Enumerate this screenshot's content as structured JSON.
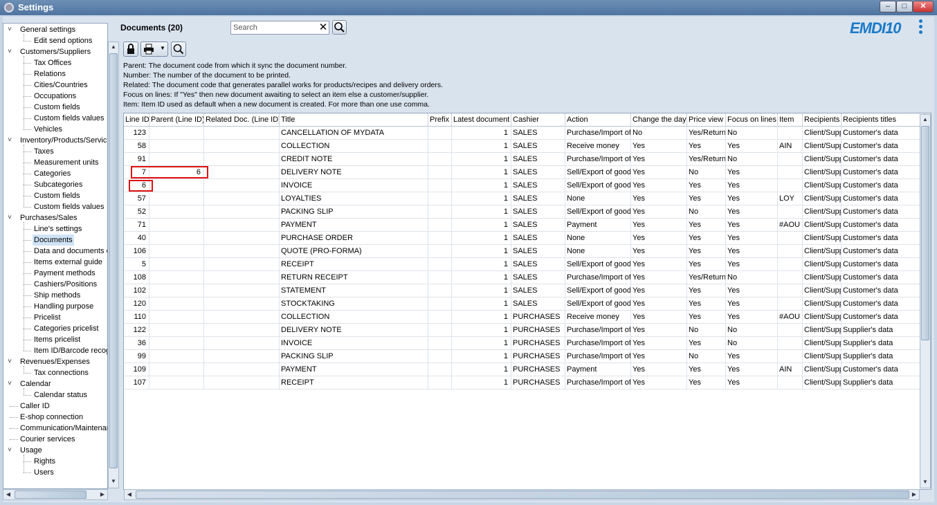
{
  "window": {
    "title": "Settings"
  },
  "sidebar": {
    "items": [
      {
        "label": "General settings",
        "level": 0,
        "expanded": true
      },
      {
        "label": "Edit send options",
        "level": 1
      },
      {
        "label": "Customers/Suppliers",
        "level": 0,
        "expanded": true
      },
      {
        "label": "Tax Offices",
        "level": 1
      },
      {
        "label": "Relations",
        "level": 1
      },
      {
        "label": "Cities/Countries",
        "level": 1
      },
      {
        "label": "Occupations",
        "level": 1
      },
      {
        "label": "Custom fields",
        "level": 1
      },
      {
        "label": "Custom fields values",
        "level": 1
      },
      {
        "label": "Vehicles",
        "level": 1
      },
      {
        "label": "Inventory/Products/Servic",
        "level": 0,
        "expanded": true
      },
      {
        "label": "Taxes",
        "level": 1
      },
      {
        "label": "Measurement units",
        "level": 1
      },
      {
        "label": "Categories",
        "level": 1
      },
      {
        "label": "Subcategories",
        "level": 1
      },
      {
        "label": "Custom fields",
        "level": 1
      },
      {
        "label": "Custom fields values",
        "level": 1
      },
      {
        "label": "Purchases/Sales",
        "level": 0,
        "expanded": true
      },
      {
        "label": "Line's settings",
        "level": 1
      },
      {
        "label": "Documents",
        "level": 1,
        "selected": true
      },
      {
        "label": "Data and documents c",
        "level": 1
      },
      {
        "label": "Items external guide",
        "level": 1
      },
      {
        "label": "Payment methods",
        "level": 1
      },
      {
        "label": "Cashiers/Positions",
        "level": 1
      },
      {
        "label": "Ship methods",
        "level": 1
      },
      {
        "label": "Handling purpose",
        "level": 1
      },
      {
        "label": "Pricelist",
        "level": 1
      },
      {
        "label": "Categories pricelist",
        "level": 1
      },
      {
        "label": "Items pricelist",
        "level": 1
      },
      {
        "label": "Item ID/Barcode recog",
        "level": 1
      },
      {
        "label": "Revenues/Expenses",
        "level": 0,
        "expanded": true
      },
      {
        "label": "Tax connections",
        "level": 1
      },
      {
        "label": "Calendar",
        "level": 0,
        "expanded": true
      },
      {
        "label": "Calendar status",
        "level": 1
      },
      {
        "label": "Caller ID",
        "level": 0
      },
      {
        "label": "E-shop connection",
        "level": 0
      },
      {
        "label": "Communication/Maintenan",
        "level": 0
      },
      {
        "label": "Courier services",
        "level": 0
      },
      {
        "label": "Usage",
        "level": 0,
        "expanded": true
      },
      {
        "label": "Rights",
        "level": 1
      },
      {
        "label": "Users",
        "level": 1
      }
    ]
  },
  "header": {
    "doc_title": "Documents (20)",
    "search_placeholder": "Search",
    "logo": "EMDI10"
  },
  "description": {
    "lines": [
      "Parent: The document code from which it sync the document number.",
      "Number: The number of the document to be printed.",
      "Related: The document code that generates parallel works for products/recipes and delivery orders.",
      "Focus on lines: If \"Yes\" then new document awaiting to select an item else a customer/supplier.",
      "Item: Item ID used as default when a new document is created. For more than one use comma."
    ]
  },
  "grid": {
    "columns": [
      "Line ID",
      "Parent (Line ID)",
      "Related Doc. (Line ID)",
      "Title",
      "Prefix",
      "Latest document",
      "Cashier",
      "Action",
      "Change the day",
      "Price view",
      "Focus on lines",
      "Item",
      "Recipients",
      "Recipients titles"
    ],
    "rows": [
      [
        "123",
        "",
        "",
        "CANCELLATION OF MYDATA",
        "",
        "1",
        "SALES",
        "Purchase/Import of",
        "No",
        "Yes/Return",
        "No",
        "",
        "Client/Supp",
        "Customer's data"
      ],
      [
        "58",
        "",
        "",
        "COLLECTION",
        "",
        "1",
        "SALES",
        "Receive money",
        "Yes",
        "Yes",
        "Yes",
        "AIN",
        "Client/Supp",
        "Customer's data"
      ],
      [
        "91",
        "",
        "",
        "CREDIT NOTE",
        "",
        "1",
        "SALES",
        "Purchase/Import of",
        "Yes",
        "Yes/Return",
        "No",
        "",
        "Client/Supp",
        "Customer's data"
      ],
      [
        "7",
        "6",
        "",
        "DELIVERY NOTE",
        "",
        "1",
        "SALES",
        "Sell/Export of good",
        "Yes",
        "No",
        "Yes",
        "",
        "Client/Supp",
        "Customer's data"
      ],
      [
        "6",
        "",
        "",
        "INVOICE",
        "",
        "1",
        "SALES",
        "Sell/Export of good",
        "Yes",
        "Yes",
        "Yes",
        "",
        "Client/Supp",
        "Customer's data"
      ],
      [
        "57",
        "",
        "",
        "LOYALTIES",
        "",
        "1",
        "SALES",
        "None",
        "Yes",
        "Yes",
        "Yes",
        "LOY",
        "Client/Supp",
        "Customer's data"
      ],
      [
        "52",
        "",
        "",
        "PACKING SLIP",
        "",
        "1",
        "SALES",
        "Sell/Export of good",
        "Yes",
        "No",
        "Yes",
        "",
        "Client/Supp",
        "Customer's data"
      ],
      [
        "71",
        "",
        "",
        "PAYMENT",
        "",
        "1",
        "SALES",
        "Payment",
        "Yes",
        "Yes",
        "Yes",
        "#AOU",
        "Client/Supp",
        "Customer's data"
      ],
      [
        "40",
        "",
        "",
        "PURCHASE ORDER",
        "",
        "1",
        "SALES",
        "None",
        "Yes",
        "Yes",
        "Yes",
        "",
        "Client/Supp",
        "Customer's data"
      ],
      [
        "106",
        "",
        "",
        "QUOTE (PRO-FORMA)",
        "",
        "1",
        "SALES",
        "None",
        "Yes",
        "Yes",
        "Yes",
        "",
        "Client/Supp",
        "Customer's data"
      ],
      [
        "5",
        "",
        "",
        "RECEIPT",
        "",
        "1",
        "SALES",
        "Sell/Export of good",
        "Yes",
        "Yes",
        "Yes",
        "",
        "Client/Supp",
        "Customer's data"
      ],
      [
        "108",
        "",
        "",
        "RETURN RECEIPT",
        "",
        "1",
        "SALES",
        "Purchase/Import of",
        "Yes",
        "Yes/Return",
        "No",
        "",
        "Client/Supp",
        "Customer's data"
      ],
      [
        "102",
        "",
        "",
        "STATEMENT",
        "",
        "1",
        "SALES",
        "Sell/Export of good",
        "Yes",
        "Yes",
        "Yes",
        "",
        "Client/Supp",
        "Customer's data"
      ],
      [
        "120",
        "",
        "",
        "STOCKTAKING",
        "",
        "1",
        "SALES",
        "Sell/Export of good",
        "Yes",
        "Yes",
        "Yes",
        "",
        "Client/Supp",
        "Customer's data"
      ],
      [
        "110",
        "",
        "",
        "COLLECTION",
        "",
        "1",
        "PURCHASES",
        "Receive money",
        "Yes",
        "Yes",
        "Yes",
        "#AOU",
        "Client/Supp",
        "Customer's data"
      ],
      [
        "122",
        "",
        "",
        "DELIVERY NOTE",
        "",
        "1",
        "PURCHASES",
        "Purchase/Import of",
        "Yes",
        "No",
        "No",
        "",
        "Client/Supp",
        "Supplier's data"
      ],
      [
        "36",
        "",
        "",
        "INVOICE",
        "",
        "1",
        "PURCHASES",
        "Purchase/Import of",
        "Yes",
        "Yes",
        "No",
        "",
        "Client/Supp",
        "Supplier's data"
      ],
      [
        "99",
        "",
        "",
        "PACKING SLIP",
        "",
        "1",
        "PURCHASES",
        "Purchase/Import of",
        "Yes",
        "No",
        "Yes",
        "",
        "Client/Supp",
        "Supplier's data"
      ],
      [
        "109",
        "",
        "",
        "PAYMENT",
        "",
        "1",
        "PURCHASES",
        "Payment",
        "Yes",
        "Yes",
        "Yes",
        "AIN",
        "Client/Supp",
        "Customer's data"
      ],
      [
        "107",
        "",
        "",
        "RECEIPT",
        "",
        "1",
        "PURCHASES",
        "Purchase/Import of",
        "Yes",
        "Yes",
        "Yes",
        "",
        "Client/Supp",
        "Supplier's data"
      ]
    ]
  },
  "colors": {
    "highlight": "#e01010",
    "logo": "#1a7ac8",
    "titlebar": "#4e74a0"
  }
}
